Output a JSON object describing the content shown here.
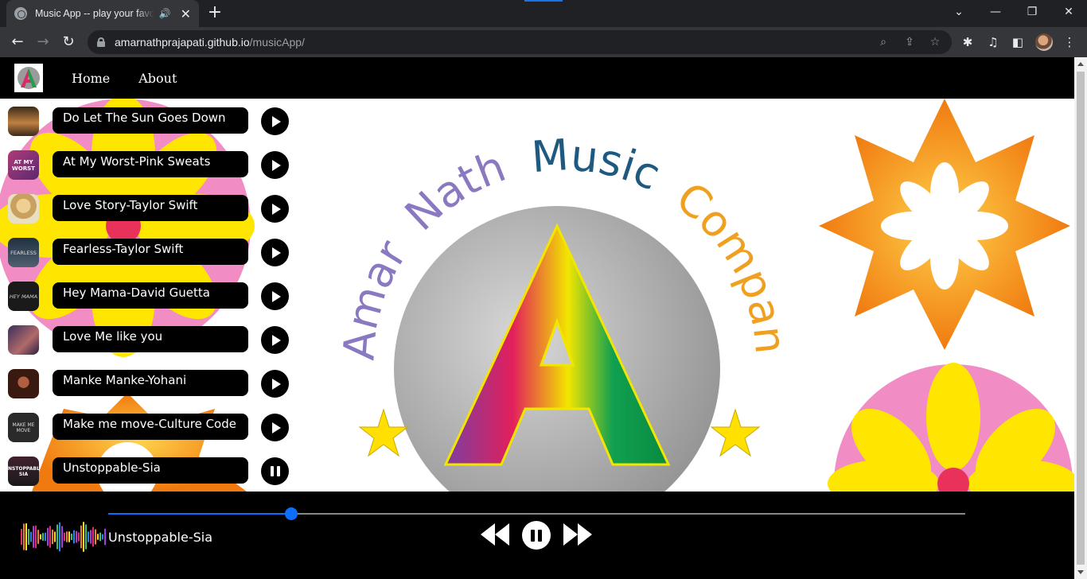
{
  "browser": {
    "tab_title": "Music App -- play your favourite music",
    "new_tab_label": "+",
    "url_host": "amarnathprajapati.github.io",
    "url_path": "/musicApp/"
  },
  "navbar": {
    "logo_letter": "A",
    "links": [
      "Home",
      "About"
    ]
  },
  "hero": {
    "logo_words": [
      "Amar",
      "Nath",
      "Music",
      "Company"
    ],
    "logo_letter": "A"
  },
  "songs": [
    {
      "title": "Do Let The Sun Goes Down",
      "state": "play"
    },
    {
      "title": "At My Worst-Pink Sweats",
      "state": "play"
    },
    {
      "title": "Love Story-Taylor Swift",
      "state": "play"
    },
    {
      "title": "Fearless-Taylor Swift",
      "state": "play"
    },
    {
      "title": "Hey Mama-David Guetta",
      "state": "play"
    },
    {
      "title": "Love Me like you",
      "state": "play"
    },
    {
      "title": "Manke Manke-Yohani",
      "state": "play"
    },
    {
      "title": "Make me move-Culture Code",
      "state": "play"
    },
    {
      "title": "Unstoppable-Sia",
      "state": "pause"
    }
  ],
  "thumb_labels": [
    "",
    "AT MY WORST",
    "",
    "FEARLESS",
    "HEY MAMA",
    "",
    "",
    "MAKE ME MOVE",
    "UNSTOPPABLE SIA"
  ],
  "player": {
    "now_playing": "Unstoppable-Sia",
    "progress_fraction": 0.214,
    "is_playing": true
  },
  "colors": {
    "accent": "#0d6efd",
    "bar_bg": "#000000",
    "page_bg": "#ffffff"
  }
}
